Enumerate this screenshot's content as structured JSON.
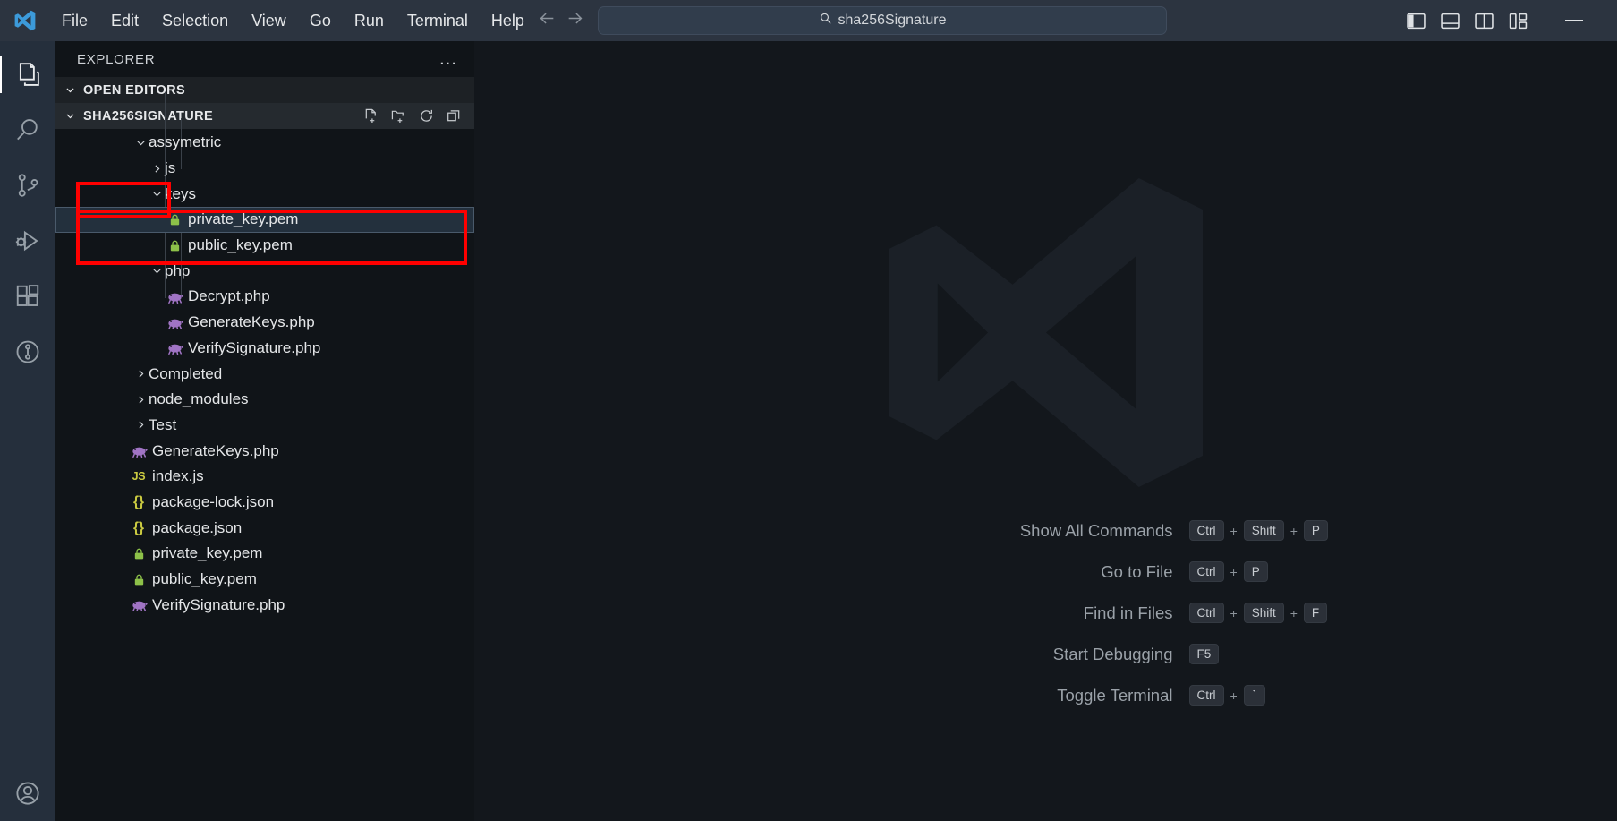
{
  "titlebar": {
    "logo_icon": "vscode-logo-icon",
    "menu": [
      "File",
      "Edit",
      "Selection",
      "View",
      "Go",
      "Run",
      "Terminal",
      "Help"
    ],
    "back_icon": "arrow-left-icon",
    "forward_icon": "arrow-right-icon",
    "command_center": {
      "icon": "search-icon",
      "value": "sha256Signature"
    },
    "layout_controls": [
      {
        "name": "toggle-primary-sidebar-icon",
        "label": "Toggle Primary Side Bar"
      },
      {
        "name": "toggle-panel-icon",
        "label": "Toggle Panel"
      },
      {
        "name": "toggle-secondary-sidebar-icon",
        "label": "Toggle Secondary Side Bar"
      },
      {
        "name": "customize-layout-icon",
        "label": "Customize Layout"
      }
    ],
    "minimize_label": "Minimize"
  },
  "activitybar": {
    "items": [
      {
        "name": "explorer",
        "icon": "files-icon",
        "label": "Explorer",
        "active": true
      },
      {
        "name": "search",
        "icon": "search-icon",
        "label": "Search",
        "active": false
      },
      {
        "name": "source-control",
        "icon": "source-control-icon",
        "label": "Source Control",
        "active": false
      },
      {
        "name": "run-debug",
        "icon": "run-and-debug-icon",
        "label": "Run and Debug",
        "active": false
      },
      {
        "name": "extensions",
        "icon": "extensions-icon",
        "label": "Extensions",
        "active": false
      },
      {
        "name": "timeline",
        "icon": "timeline-icon",
        "label": "Timeline",
        "active": false
      }
    ],
    "bottom": [
      {
        "name": "accounts",
        "icon": "account-icon",
        "label": "Accounts"
      }
    ]
  },
  "explorer": {
    "title": "EXPLORER",
    "more_actions": "…",
    "open_editors": {
      "label": "OPEN EDITORS",
      "expanded": true
    },
    "workspace": {
      "label": "SHA256SIGNATURE",
      "expanded": true,
      "actions": [
        {
          "name": "new-file-icon",
          "label": "New File"
        },
        {
          "name": "new-folder-icon",
          "label": "New Folder"
        },
        {
          "name": "refresh-icon",
          "label": "Refresh Explorer"
        },
        {
          "name": "collapse-all-icon",
          "label": "Collapse Folders in Explorer"
        }
      ]
    },
    "tree": [
      {
        "name": "assymetric",
        "type": "folder",
        "depth": 1,
        "expanded": true,
        "icon": "chevron-down-icon"
      },
      {
        "name": "js",
        "type": "folder",
        "depth": 2,
        "expanded": false,
        "icon": "chevron-right-icon"
      },
      {
        "name": "keys",
        "type": "folder",
        "depth": 2,
        "expanded": true,
        "icon": "chevron-down-icon",
        "highlighted": true
      },
      {
        "name": "private_key.pem",
        "type": "file",
        "depth": 3,
        "icon": "lock-icon",
        "selected": true,
        "highlighted": true
      },
      {
        "name": "public_key.pem",
        "type": "file",
        "depth": 3,
        "icon": "lock-icon",
        "highlighted": true
      },
      {
        "name": "php",
        "type": "folder",
        "depth": 2,
        "expanded": true,
        "icon": "chevron-down-icon"
      },
      {
        "name": "Decrypt.php",
        "type": "file",
        "depth": 3,
        "icon": "php-icon"
      },
      {
        "name": "GenerateKeys.php",
        "type": "file",
        "depth": 3,
        "icon": "php-icon"
      },
      {
        "name": "VerifySignature.php",
        "type": "file",
        "depth": 3,
        "icon": "php-icon"
      },
      {
        "name": "Completed",
        "type": "folder",
        "depth": 1,
        "expanded": false,
        "icon": "chevron-right-icon"
      },
      {
        "name": "node_modules",
        "type": "folder",
        "depth": 1,
        "expanded": false,
        "icon": "chevron-right-icon"
      },
      {
        "name": "Test",
        "type": "folder",
        "depth": 1,
        "expanded": false,
        "icon": "chevron-right-icon"
      },
      {
        "name": "GenerateKeys.php",
        "type": "file",
        "depth": 1,
        "icon": "php-icon"
      },
      {
        "name": "index.js",
        "type": "file",
        "depth": 1,
        "icon": "js-icon"
      },
      {
        "name": "package-lock.json",
        "type": "file",
        "depth": 1,
        "icon": "json-icon"
      },
      {
        "name": "package.json",
        "type": "file",
        "depth": 1,
        "icon": "json-icon"
      },
      {
        "name": "private_key.pem",
        "type": "file",
        "depth": 1,
        "icon": "lock-icon"
      },
      {
        "name": "public_key.pem",
        "type": "file",
        "depth": 1,
        "icon": "lock-icon"
      },
      {
        "name": "VerifySignature.php",
        "type": "file",
        "depth": 1,
        "icon": "php-icon"
      }
    ]
  },
  "editor": {
    "watermark_icon": "vscode-watermark-logo",
    "shortcuts": [
      {
        "label": "Show All Commands",
        "keys": [
          "Ctrl",
          "Shift",
          "P"
        ]
      },
      {
        "label": "Go to File",
        "keys": [
          "Ctrl",
          "P"
        ]
      },
      {
        "label": "Find in Files",
        "keys": [
          "Ctrl",
          "Shift",
          "F"
        ]
      },
      {
        "label": "Start Debugging",
        "keys": [
          "F5"
        ]
      },
      {
        "label": "Toggle Terminal",
        "keys": [
          "Ctrl",
          "`"
        ]
      }
    ]
  },
  "colors": {
    "titlebar_bg": "#2c3440",
    "activitybar_bg": "#252f3c",
    "sidebar_bg": "#101418",
    "editor_bg": "#13171c",
    "annotation_red": "#ff0000",
    "lock_green": "#8dc149",
    "php_purple": "#a074c4",
    "js_yellow": "#cbcb41"
  }
}
